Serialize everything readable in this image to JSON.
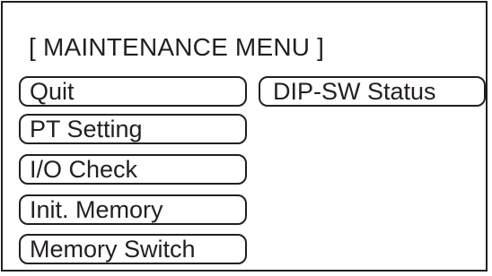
{
  "menu": {
    "title": "[ MAINTENANCE MENU ]",
    "buttons": {
      "quit": "Quit",
      "dip_sw_status": "DIP-SW Status",
      "pt_setting": "PT Setting",
      "io_check": "I/O Check",
      "init_memory": "Init. Memory",
      "memory_switch": "Memory Switch"
    }
  }
}
